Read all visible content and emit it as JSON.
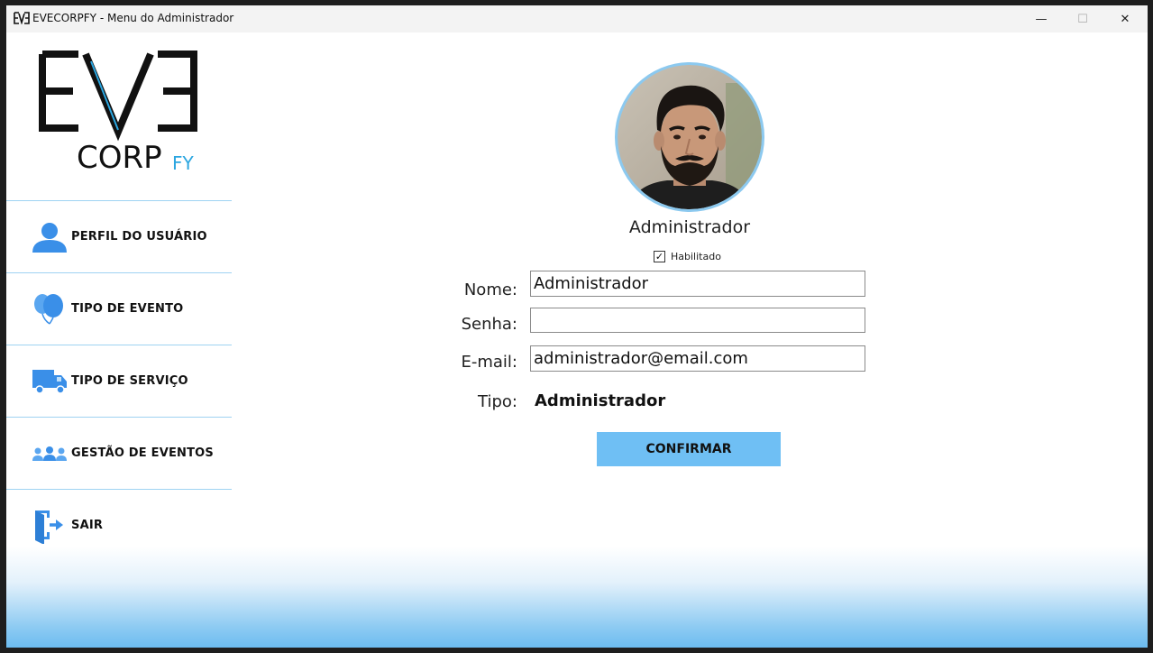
{
  "window": {
    "title": "EVECORPFY - Menu do Administrador",
    "minimize_glyph": "—",
    "maximize_glyph": "☐",
    "close_glyph": "✕"
  },
  "logo": {
    "eve": "EVE",
    "corp": "CORP",
    "fy": "FY"
  },
  "sidebar": {
    "items": [
      {
        "label": "PERFIL DO USUÁRIO",
        "icon": "user-icon"
      },
      {
        "label": "TIPO DE EVENTO",
        "icon": "balloons-icon"
      },
      {
        "label": "TIPO DE SERVIÇO",
        "icon": "truck-icon"
      },
      {
        "label": "GESTÃO DE EVENTOS",
        "icon": "people-group-icon"
      },
      {
        "label": "SAIR",
        "icon": "exit-door-icon"
      }
    ]
  },
  "profile": {
    "display_name": "Administrador",
    "enabled_checked": true,
    "enabled_mark": "✓",
    "enabled_label": "Habilitado"
  },
  "form": {
    "name_label": "Nome:",
    "name_value": "Administrador",
    "password_label": "Senha:",
    "password_value": "",
    "email_label": "E-mail:",
    "email_value": "administrador@email.com",
    "type_label": "Tipo:",
    "type_value": "Administrador",
    "confirm_label": "CONFIRMAR"
  },
  "colors": {
    "accent": "#6fbff4",
    "icon_blue": "#3a8fe8",
    "divider": "#9fd3f2"
  }
}
